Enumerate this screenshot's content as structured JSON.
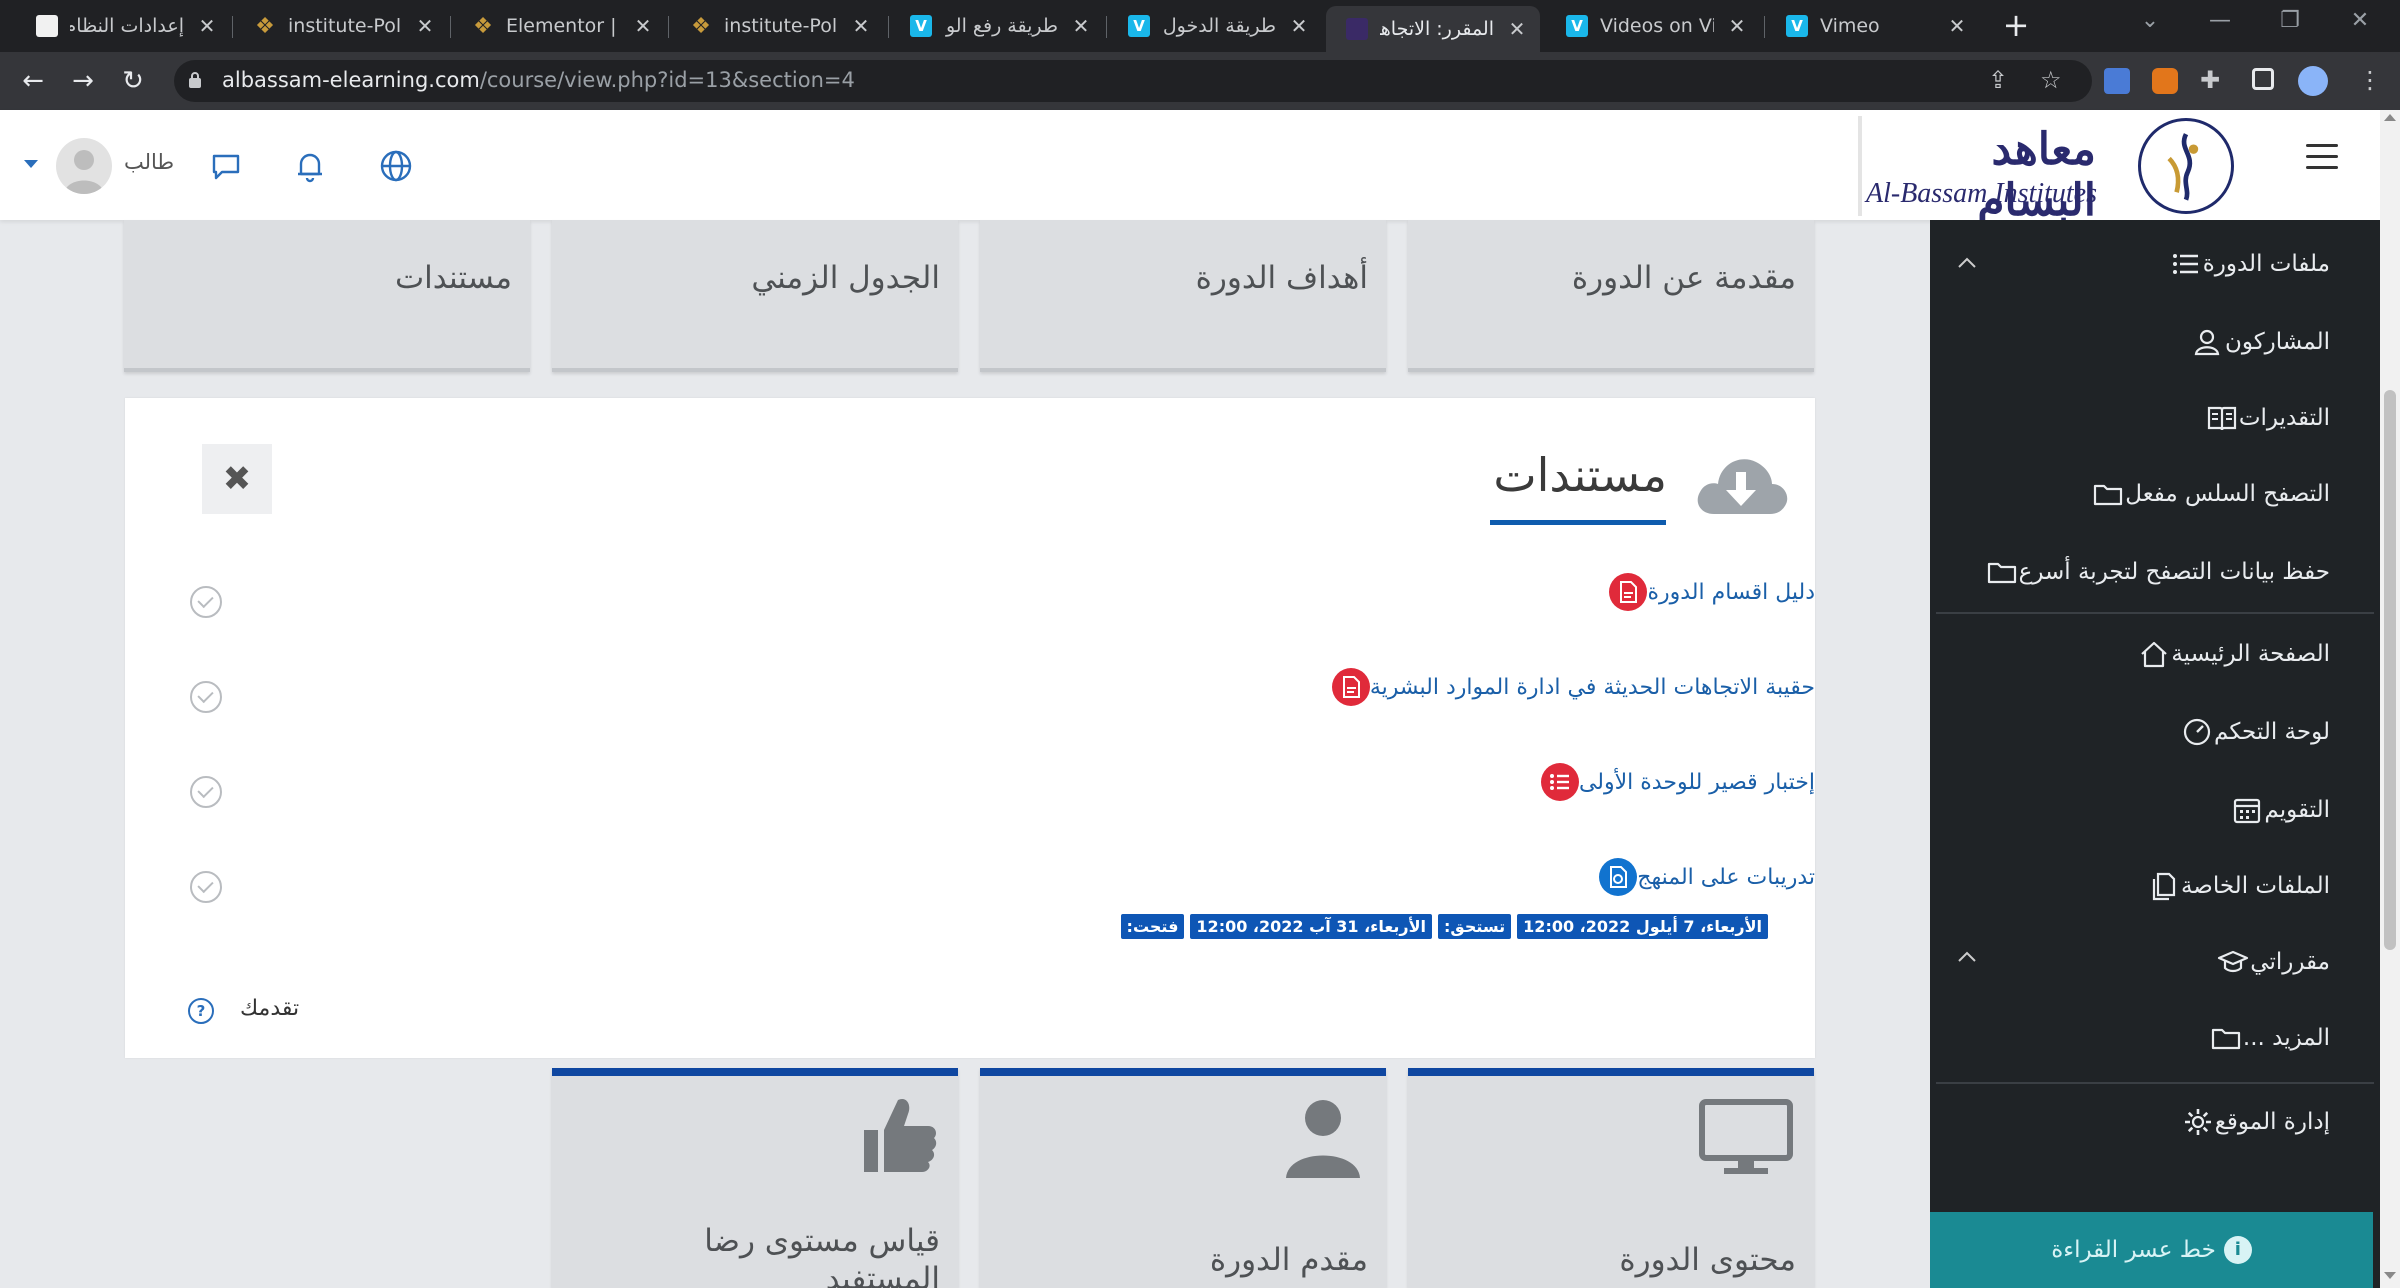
{
  "browser": {
    "tabs": [
      {
        "title": "إعدادات النظام",
        "favicon": "white",
        "active": false
      },
      {
        "title": "institute-Polic",
        "favicon": "gold",
        "active": false
      },
      {
        "title": "Elementor | in",
        "favicon": "gold",
        "active": false
      },
      {
        "title": "institute-Polic",
        "favicon": "gold",
        "active": false
      },
      {
        "title": "طريقة رفع الو",
        "favicon": "vimeo",
        "active": false
      },
      {
        "title": "طريقة الدخول",
        "favicon": "vimeo",
        "active": false
      },
      {
        "title": "المقرر: الاتجاهات",
        "favicon": "purple",
        "active": true
      },
      {
        "title": "Videos on Vin",
        "favicon": "vimeo",
        "active": false
      },
      {
        "title": "Vimeo",
        "favicon": "vimeo",
        "active": false
      }
    ],
    "vimeo_letter": "V",
    "close_glyph": "✕",
    "new_tab": "+",
    "url_host": "albassam-elearning.com",
    "url_path": "/course/view.php?id=13&section=4",
    "accent": "#1ab7ea"
  },
  "header": {
    "logo_ar": "معاهد البسام",
    "logo_en": "Al-Bassam Institutes",
    "user_name": "طالب"
  },
  "sidebar": {
    "items": [
      {
        "label": "ملفات الدورة",
        "icon": "list-icon"
      },
      {
        "label": "المشاركون",
        "icon": "users-icon"
      },
      {
        "label": "التقديرات",
        "icon": "grades-icon"
      },
      {
        "label": "التصفح السلس مفعل",
        "icon": "folder-icon"
      },
      {
        "label": "حفظ بيانات التصفح لتجربة أسرع",
        "icon": "folder-icon"
      },
      {
        "label": "الصفحة الرئيسية",
        "icon": "home-icon"
      },
      {
        "label": "لوحة التحكم",
        "icon": "dashboard-icon"
      },
      {
        "label": "التقويم",
        "icon": "calendar-icon"
      },
      {
        "label": "الملفات الخاصة",
        "icon": "files-icon"
      },
      {
        "label": "مقرراتي",
        "icon": "graduation-cap-icon"
      },
      {
        "label": "المزيد ...",
        "icon": "folder-icon"
      },
      {
        "label": "إدارة الموقع",
        "icon": "gear-icon"
      }
    ],
    "reading_button": "خط عسر القراءة",
    "reading_icon_glyph": "i",
    "background": "#1f2326",
    "reading_color": "#1a8a93"
  },
  "tiles_top": [
    "مقدمة عن الدورة",
    "أهداف الدورة",
    "الجدول الزمني",
    "مستندات"
  ],
  "panel": {
    "title": "مستندات",
    "close_glyph": "✖",
    "activities": [
      {
        "label": "دليل اقسام الدورة",
        "icon": "pdf-icon",
        "color": "red"
      },
      {
        "label": "حقيبة الاتجاهات الحديثة في ادارة الموارد البشرية",
        "icon": "pdf-icon",
        "color": "red"
      },
      {
        "label": "إختبار قصير للوحدة الأولى",
        "icon": "quiz-icon",
        "color": "red"
      },
      {
        "label": "تدريبات على المنهج",
        "icon": "assignment-icon",
        "color": "blue"
      }
    ],
    "dates": [
      {
        "label": "فتحت:"
      },
      {
        "label": "الأربعاء، 31 آب 2022، 12:00"
      },
      {
        "label": "تستحق:"
      },
      {
        "label": "الأربعاء، 7 أيلول 2022، 12:00"
      }
    ],
    "progress_label": "تقدمك",
    "help_glyph": "?"
  },
  "tiles_bottom": [
    "محتوى الدورة",
    "مقدم الدورة",
    "قياس مستوى رضا المستفيد"
  ],
  "colors": {
    "primary_blue": "#0f47a1",
    "link_blue": "#1a5fa8",
    "danger_red": "#e02a3a"
  }
}
